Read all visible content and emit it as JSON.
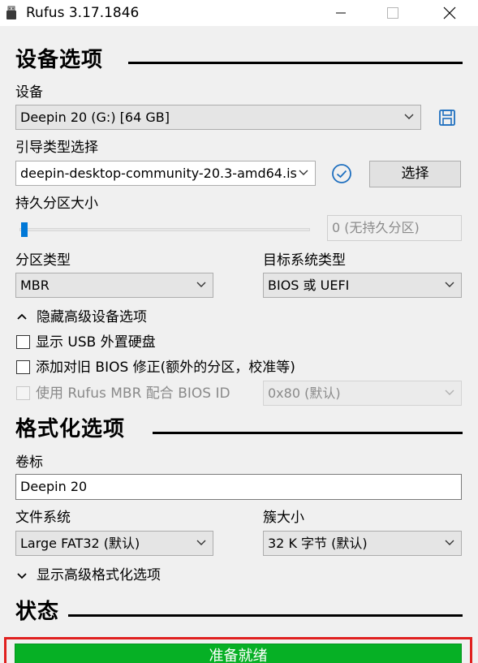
{
  "window": {
    "title": "Rufus 3.17.1846"
  },
  "device_section": {
    "title": "设备选项",
    "device_label": "设备",
    "device_value": "Deepin 20 (G:) [64 GB]",
    "boot_label": "引导类型选择",
    "boot_value": "deepin-desktop-community-20.3-amd64.is",
    "select_button": "选择",
    "persistent_label": "持久分区大小",
    "persistent_value": "0 (无持久分区)",
    "persistent_level": 0,
    "partition_label": "分区类型",
    "partition_value": "MBR",
    "target_label": "目标系统类型",
    "target_value": "BIOS 或 UEFI",
    "advanced_toggle": "隐藏高级设备选项",
    "opt_usb_hdd": "显示 USB 外置硬盘",
    "opt_old_bios": "添加对旧 BIOS 修正(额外的分区，校准等)",
    "opt_rufus_mbr": "使用 Rufus MBR 配合 BIOS ID",
    "bios_id_value": "0x80 (默认)"
  },
  "format_section": {
    "title": "格式化选项",
    "volume_label": "卷标",
    "volume_value": "Deepin 20",
    "fs_label": "文件系统",
    "fs_value": "Large FAT32 (默认)",
    "cluster_label": "簇大小",
    "cluster_value": "32 K 字节 (默认)",
    "advanced_toggle": "显示高级格式化选项"
  },
  "status_section": {
    "title": "状态",
    "status_text": "准备就绪",
    "progress_color": "#06b025",
    "highlight_color": "#e0201f"
  },
  "icons": {
    "app": "usb-drive-icon",
    "save": "floppy-save-icon",
    "check": "check-circle-icon",
    "collapse": "chevron-up-icon",
    "expand": "chevron-down-icon"
  }
}
